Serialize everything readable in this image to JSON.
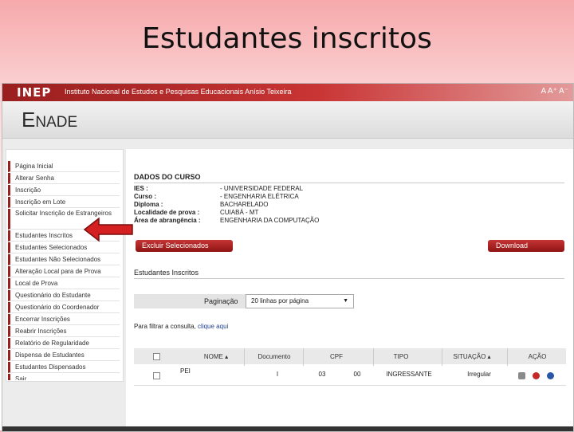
{
  "slide": {
    "title": "Estudantes inscritos"
  },
  "header": {
    "logo": "INEP",
    "institute_name": "Instituto Nacional de Estudos e Pesquisas Educacionais Anísio Teixeira",
    "font_controls": "A  A⁺  A⁻"
  },
  "brand": {
    "enade_first": "E",
    "enade_rest": "NADE"
  },
  "sidebar": {
    "items": [
      {
        "label": "Página Inicial"
      },
      {
        "label": "Alterar Senha"
      },
      {
        "label": "Inscrição"
      },
      {
        "label": "Inscrição em Lote"
      },
      {
        "label": "Solicitar Inscrição de Estrangeiros"
      },
      {
        "label": "Estudantes Inscritos"
      },
      {
        "label": "Estudantes Selecionados"
      },
      {
        "label": "Estudantes Não Selecionados"
      },
      {
        "label": "Alteração Local para de Prova"
      },
      {
        "label": "Local de Prova"
      },
      {
        "label": "Questionário do Estudante"
      },
      {
        "label": "Questionário do Coordenador"
      },
      {
        "label": "Encerrar Inscrições"
      },
      {
        "label": "Reabrir Inscrições"
      },
      {
        "label": "Relatório de Regularidade"
      },
      {
        "label": "Dispensa de Estudantes"
      },
      {
        "label": "Estudantes Dispensados"
      },
      {
        "label": "Sair"
      }
    ]
  },
  "course": {
    "section_title": "DADOS DO CURSO",
    "fields": [
      {
        "key": "IES :",
        "value": "- UNIVERSIDADE FEDERAL"
      },
      {
        "key": "Curso :",
        "value": "- ENGENHARIA ELÉTRICA"
      },
      {
        "key": "Diploma :",
        "value": "BACHARELADO"
      },
      {
        "key": "Localidade de prova :",
        "value": "CUIABÁ - MT"
      },
      {
        "key": "Área de abrangência :",
        "value": "ENGENHARIA DA COMPUTAÇÃO"
      }
    ]
  },
  "actions": {
    "delete_selected": "Excluir Selecionados",
    "download": "Download"
  },
  "students": {
    "section_title": "Estudantes Inscritos",
    "pagination_label": "Paginação",
    "pagination_value": "20 linhas por página",
    "filter_prefix": "Para filtrar a consulta,",
    "filter_link": "clique aqui",
    "columns": [
      "NOME ▴",
      "Documento",
      "CPF",
      "TIPO",
      "SITUAÇÃO ▴",
      "AÇÃO"
    ],
    "rows": [
      {
        "name": "PEI",
        "document": "I",
        "cpf_start": "03",
        "cpf_end": "00",
        "type": "INGRESSANTE",
        "status": "Irregular"
      }
    ]
  },
  "colors": {
    "brand_red": "#9a1f1f",
    "link_blue": "#1f3f8f",
    "arrow_red": "#d42020"
  }
}
